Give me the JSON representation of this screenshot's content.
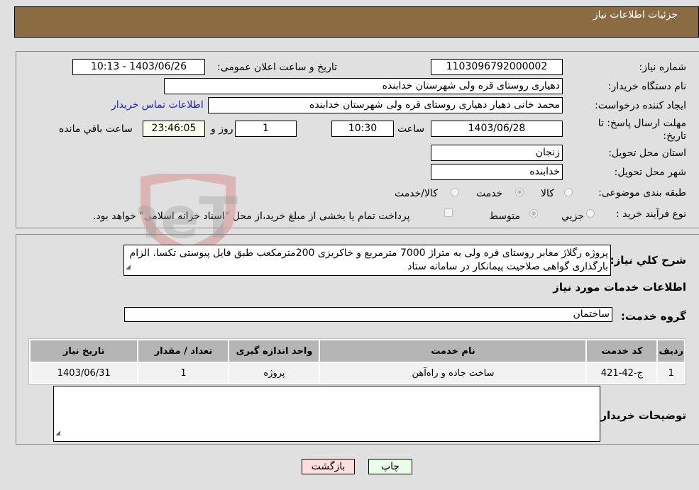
{
  "header": {
    "title": "جزئیات اطلاعات نیاز"
  },
  "fields": {
    "need_number": {
      "label": "شماره نیاز:",
      "value": "1103096792000002"
    },
    "announce_datetime": {
      "label": "تاریخ و ساعت اعلان عمومی:",
      "value": "1403/06/26 - 10:13"
    },
    "buyer_org": {
      "label": "نام دستگاه خریدار:",
      "value": "دهیاری روستای قره ولی شهرستان خدابنده"
    },
    "requester": {
      "label": "ایجاد کننده درخواست:",
      "value": "محمد خانی دهیار دهیاری روستای قره ولی شهرستان خدابنده"
    },
    "buyer_contact_link": "اطلاعات تماس خریدار",
    "deadline": {
      "label": "مهلت ارسال پاسخ: تا تاریخ:",
      "date": "1403/06/28",
      "time_label": "ساعت",
      "time": "10:30",
      "days": "1",
      "days_label": "روز و",
      "remaining": "23:46:05",
      "remaining_label": "ساعت باقي مانده"
    },
    "province": {
      "label": "استان محل تحویل:",
      "value": "زنجان"
    },
    "city": {
      "label": "شهر محل تحویل:",
      "value": "خدابنده"
    },
    "category": {
      "label": "طبقه بندی موضوعی:",
      "options": [
        "کالا",
        "خدمت",
        "کالا/خدمت"
      ],
      "selected": "خدمت"
    },
    "purchase_type": {
      "label": "نوع فرآیند خرید :",
      "options": [
        "جزيي",
        "متوسط"
      ],
      "selected": "متوسط",
      "treasury_note": "پرداخت تمام یا بخشی از مبلغ خرید،از محل \"اسناد خزانه اسلامی\" خواهد بود."
    }
  },
  "description": {
    "label": "شرح كلي نياز:",
    "text": "پروژه رگلاژ معابر روستای قره ولی به متراژ 7000 مترمربع و خاکریزی 200مترمکعب طبق فایل پیوستی تکسا. الزام بارگذاری گواهی صلاحیت پیمانکار در سامانه ستاد"
  },
  "services_section": {
    "title": "اطلاعات خدمات مورد نیاز",
    "group_label": "گروه خدمت:",
    "group_value": "ساختمان",
    "table": {
      "headers": [
        "ردیف",
        "کد خدمت",
        "نام خدمت",
        "واحد اندازه گیری",
        "تعداد / مقدار",
        "تاریخ نیاز"
      ],
      "rows": [
        [
          "1",
          "ج-42-421",
          "ساخت جاده و راه‌آهن",
          "پروژه",
          "1",
          "1403/06/31"
        ]
      ]
    }
  },
  "buyer_notes": {
    "label": "توضیحات خریدار:",
    "value": ""
  },
  "buttons": {
    "print": "چاپ",
    "back": "بازگشت"
  },
  "watermark": "AriaTender.neT",
  "colors": {
    "header_bg": "#8b6c42",
    "print_bg": "#eaffea",
    "back_bg": "#ffdede",
    "link": "#2222bb"
  }
}
